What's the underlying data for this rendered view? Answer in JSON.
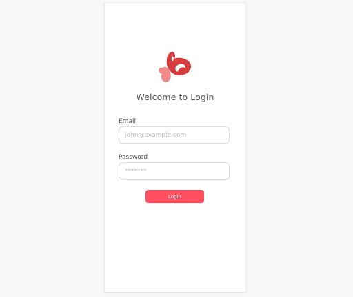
{
  "login": {
    "title": "Welcome to Login",
    "email_label": "Email",
    "email_placeholder": "john@example.com",
    "password_label": "Password",
    "password_placeholder": "*******",
    "login_button": "Login"
  },
  "icons": {
    "logo": "butterfly-logo-icon"
  },
  "colors": {
    "page_background": "#f7f7f7",
    "card_background": "#ffffff",
    "accent": "#ff4f5e",
    "logo_dark": "#d73c3f",
    "logo_light": "#f08a8a"
  }
}
